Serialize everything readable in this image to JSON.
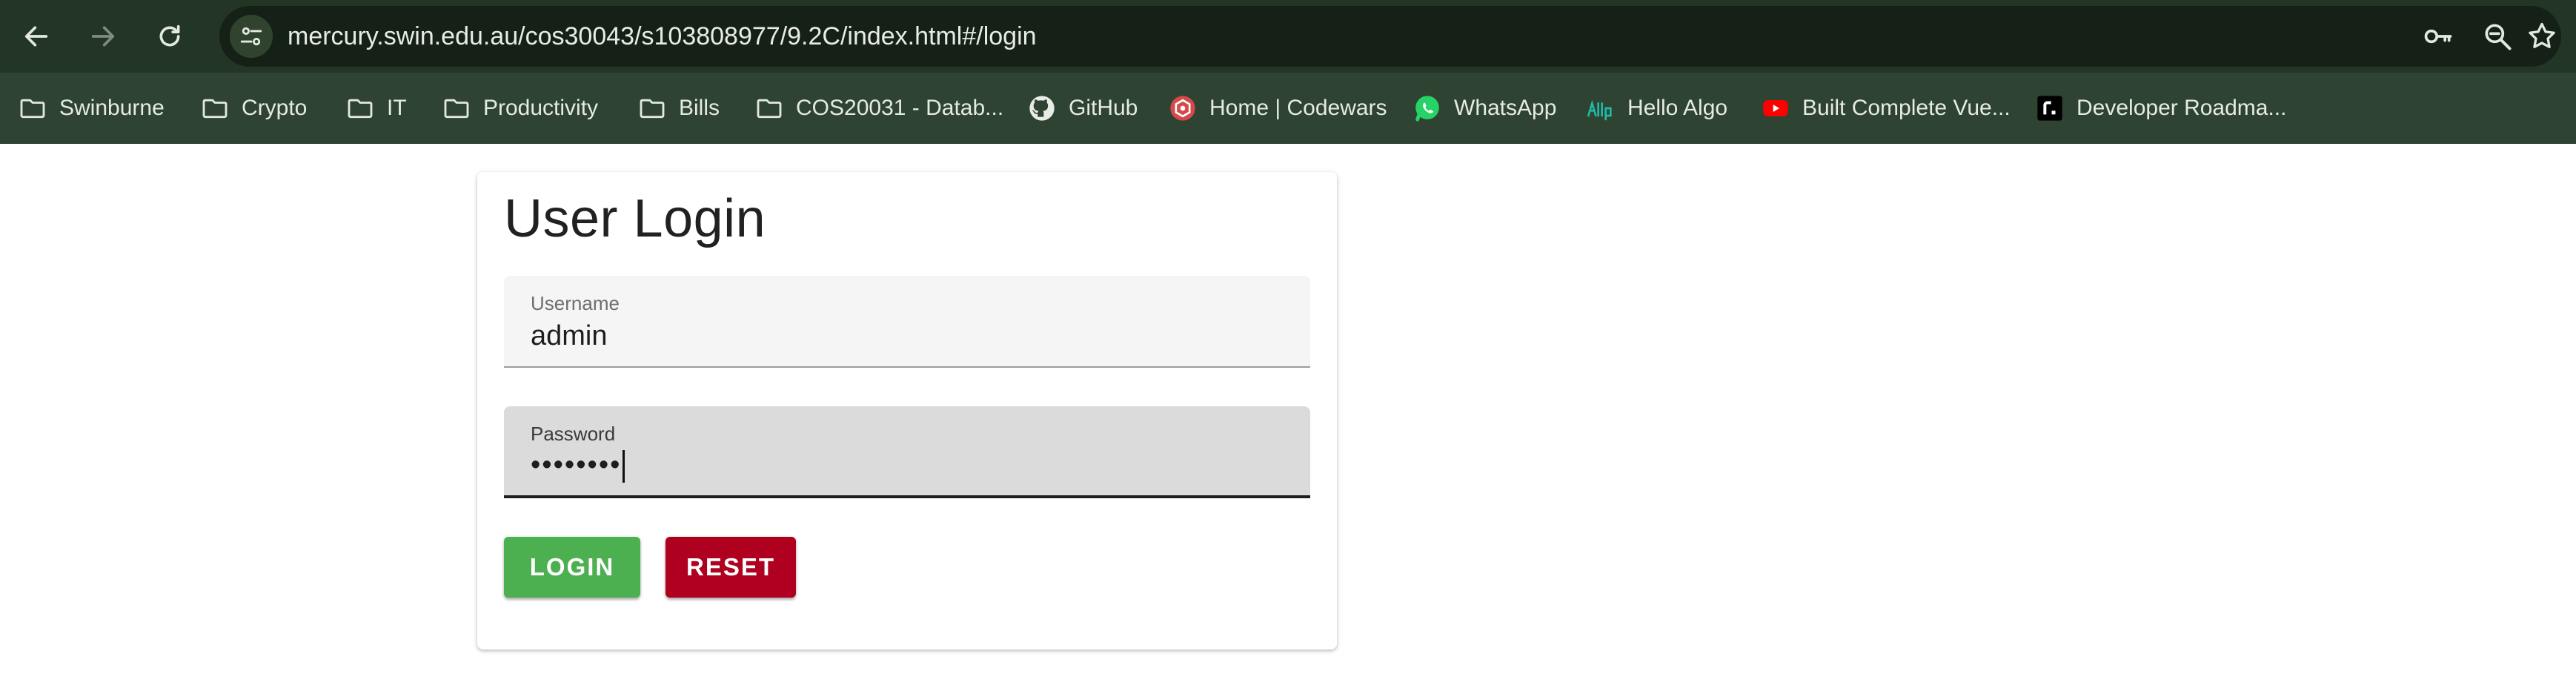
{
  "browser": {
    "url": "mercury.swin.edu.au/cos30043/s103808977/9.2C/index.html#/login",
    "nav": {
      "back_icon": "arrow-left-icon",
      "forward_icon": "arrow-right-icon",
      "reload_icon": "reload-icon"
    },
    "omnibox_icons": [
      "site-settings-icon",
      "password-key-icon",
      "zoom-icon",
      "bookmark-star-icon"
    ],
    "bookmarks": [
      {
        "label": "Swinburne",
        "icon": "folder-icon"
      },
      {
        "label": "Crypto",
        "icon": "folder-icon"
      },
      {
        "label": "IT",
        "icon": "folder-icon"
      },
      {
        "label": "Productivity",
        "icon": "folder-icon"
      },
      {
        "label": "Bills",
        "icon": "folder-icon"
      },
      {
        "label": "COS20031 - Datab...",
        "icon": "folder-icon"
      },
      {
        "label": "GitHub",
        "icon": "github-icon"
      },
      {
        "label": "Home | Codewars",
        "icon": "codewars-icon"
      },
      {
        "label": "WhatsApp",
        "icon": "whatsapp-icon"
      },
      {
        "label": "Hello Algo",
        "icon": "hello-algo-icon"
      },
      {
        "label": "Built Complete Vue...",
        "icon": "youtube-icon"
      },
      {
        "label": "Developer Roadma...",
        "icon": "roadmap-icon"
      }
    ]
  },
  "login": {
    "title": "User Login",
    "username_label": "Username",
    "username_value": "admin",
    "password_label": "Password",
    "password_masked": "••••••••",
    "login_label": "LOGIN",
    "reset_label": "RESET"
  },
  "colors": {
    "toolbar": "#233524",
    "bookmark_bar": "#2e4331",
    "login_button": "#4caf50",
    "reset_button": "#b00020"
  }
}
